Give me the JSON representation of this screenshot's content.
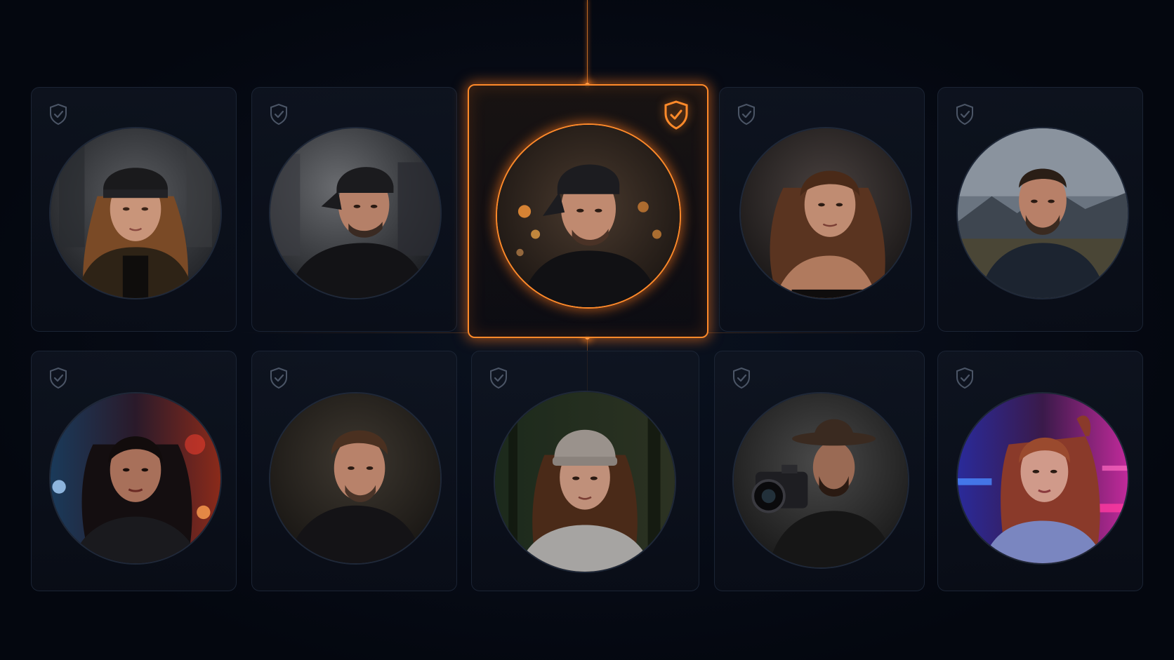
{
  "colors": {
    "background": "#050912",
    "accent": "#ff8a2a",
    "card_border": "#1b2434",
    "shield_inactive": "#4b5566"
  },
  "grid": {
    "selected_index": 2,
    "rows": [
      {
        "cards": [
          {
            "avatar": "woman-beanie-portrait",
            "shield_icon": "shield-check-icon",
            "verified": true
          },
          {
            "avatar": "man-backwards-cap-portrait",
            "shield_icon": "shield-check-icon",
            "verified": true
          },
          {
            "avatar": "man-backwards-cap-bokeh-portrait",
            "shield_icon": "shield-check-icon",
            "verified": true,
            "selected": true
          },
          {
            "avatar": "woman-wavy-hair-portrait",
            "shield_icon": "shield-check-icon",
            "verified": true
          },
          {
            "avatar": "man-mountains-portrait",
            "shield_icon": "shield-check-icon",
            "verified": true
          }
        ]
      },
      {
        "cards": [
          {
            "avatar": "woman-neon-red-portrait",
            "shield_icon": "shield-check-icon",
            "verified": true
          },
          {
            "avatar": "man-hoodie-portrait",
            "shield_icon": "shield-check-icon",
            "verified": true
          },
          {
            "avatar": "woman-knit-beanie-forest-portrait",
            "shield_icon": "shield-check-icon",
            "verified": true
          },
          {
            "avatar": "photographer-hat-camera-portrait",
            "shield_icon": "shield-check-icon",
            "verified": true
          },
          {
            "avatar": "woman-neon-pink-portrait",
            "shield_icon": "shield-check-icon",
            "verified": true
          }
        ]
      }
    ]
  }
}
